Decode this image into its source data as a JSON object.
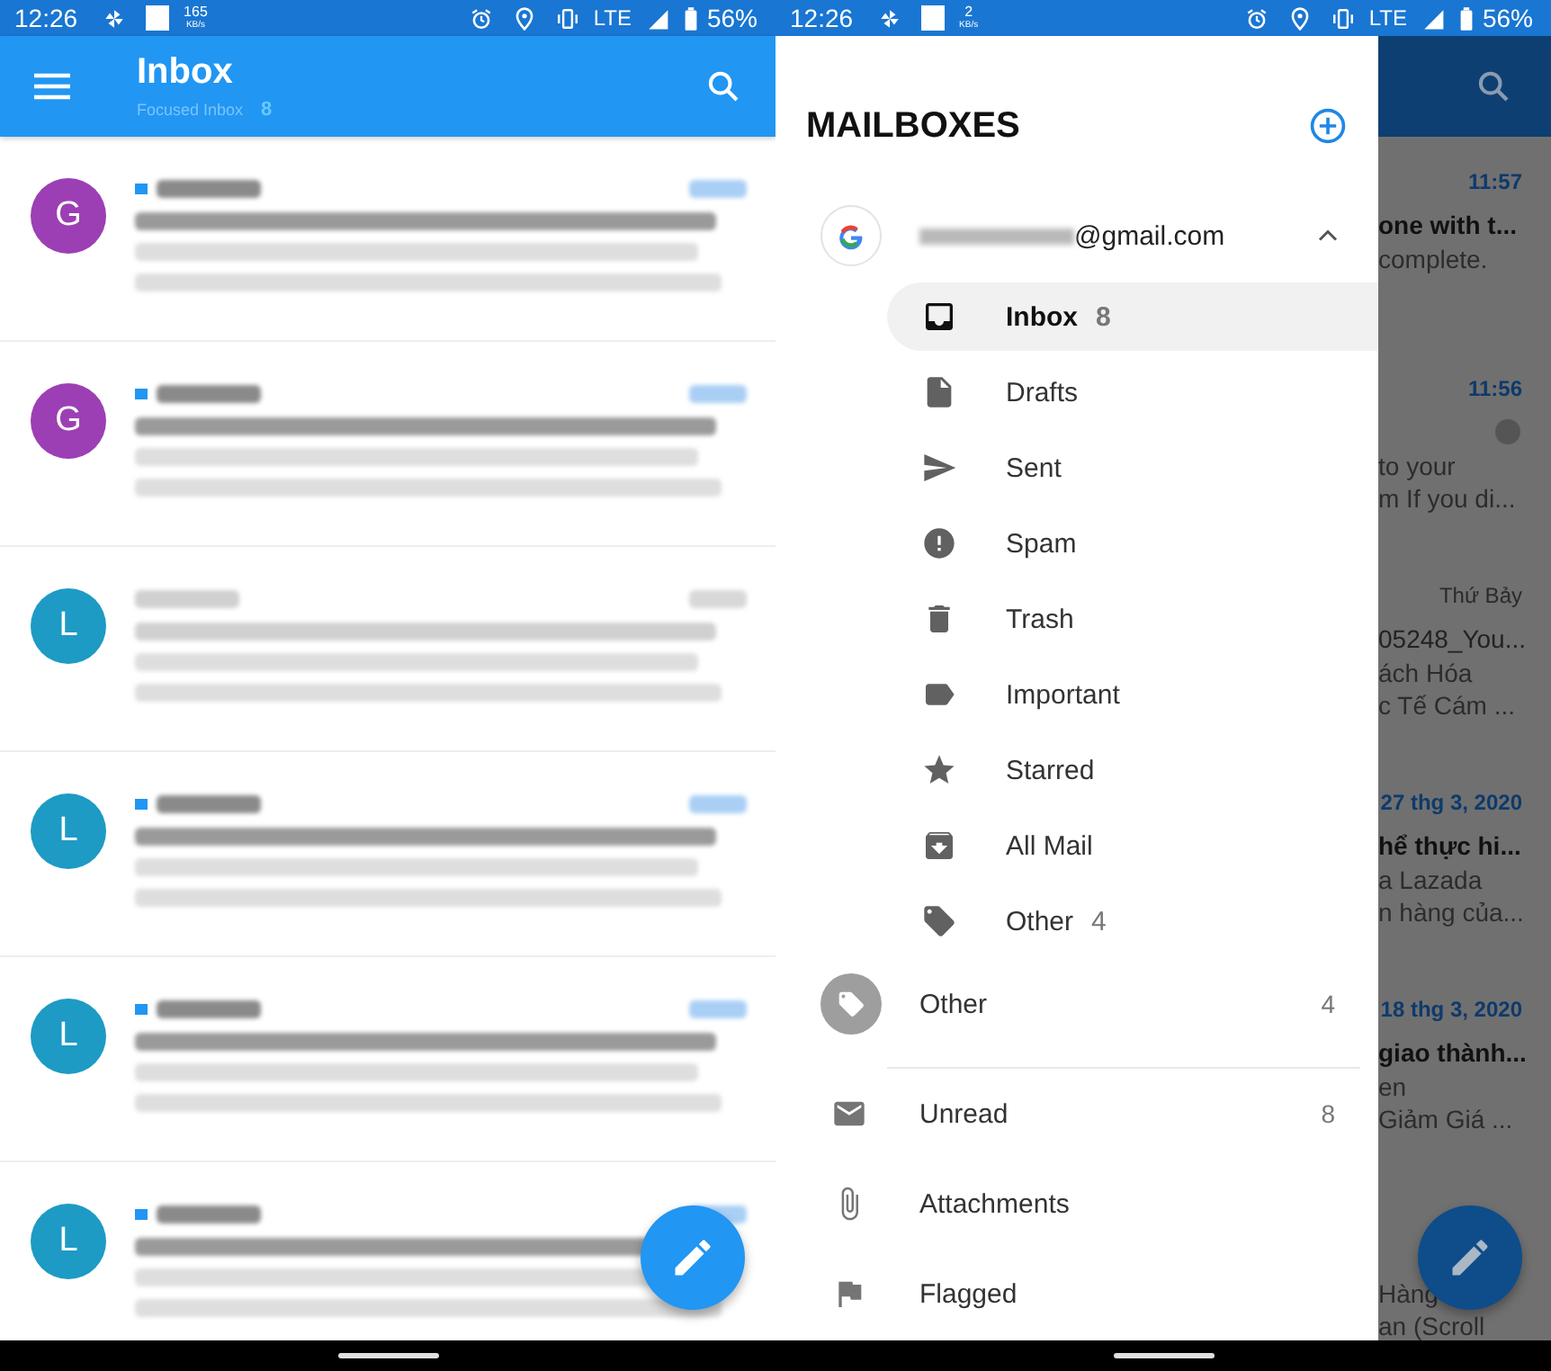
{
  "left_screen": {
    "status_bar": {
      "time": "12:26",
      "speed": "165",
      "speed_unit": "KB/s",
      "network": "LTE",
      "battery": "56%"
    },
    "app_bar": {
      "title": "Inbox",
      "subtitle": "Focused Inbox",
      "count": "8"
    },
    "messages": [
      {
        "avatar": "G",
        "color": "#9c3fb4",
        "unread": true
      },
      {
        "avatar": "G",
        "color": "#9c3fb4",
        "unread": true
      },
      {
        "avatar": "L",
        "color": "#1d9bc4",
        "unread": false
      },
      {
        "avatar": "L",
        "color": "#1d9bc4",
        "unread": true
      },
      {
        "avatar": "L",
        "color": "#1d9bc4",
        "unread": true
      },
      {
        "avatar": "L",
        "color": "#1d9bc4",
        "unread": true
      }
    ]
  },
  "right_screen": {
    "status_bar": {
      "time": "12:26",
      "speed": "2",
      "speed_unit": "KB/s",
      "network": "LTE",
      "battery": "56%"
    },
    "drawer": {
      "title": "MAILBOXES",
      "account": {
        "email_visible": "@gmail.com",
        "expanded": true
      },
      "folders": [
        {
          "kind": "inbox",
          "label": "Inbox",
          "count": "8",
          "selected": true
        },
        {
          "kind": "drafts",
          "label": "Drafts",
          "selected": false
        },
        {
          "kind": "sent",
          "label": "Sent",
          "selected": false
        },
        {
          "kind": "spam",
          "label": "Spam",
          "selected": false
        },
        {
          "kind": "trash",
          "label": "Trash",
          "selected": false
        },
        {
          "kind": "label",
          "label": "Important",
          "selected": false
        },
        {
          "kind": "star",
          "label": "Starred",
          "selected": false
        },
        {
          "kind": "allmail",
          "label": "All Mail",
          "selected": false
        },
        {
          "kind": "tag",
          "label": "Other",
          "count": "4",
          "selected": false
        }
      ],
      "other_account": {
        "label": "Other",
        "count": "4"
      },
      "filters": [
        {
          "kind": "mail",
          "label": "Unread",
          "count": "8"
        },
        {
          "kind": "attach",
          "label": "Attachments"
        },
        {
          "kind": "flag",
          "label": "Flagged"
        }
      ]
    },
    "background_rows": [
      {
        "unread": true,
        "time": "11:57",
        "subject": "one with t...",
        "snippets": [
          "complete."
        ]
      },
      {
        "unread": true,
        "time": "11:56",
        "icon": true,
        "snippets": [
          "to your",
          "m If you di..."
        ]
      },
      {
        "unread": false,
        "time": "Thứ Bảy",
        "subject": "05248_You...",
        "snippets": [
          "ách Hóa",
          "c Tế Cám ..."
        ]
      },
      {
        "unread": true,
        "time": "27 thg 3, 2020",
        "subject": "hể thực hi...",
        "snippets": [
          "a Lazada",
          "n hàng của..."
        ]
      },
      {
        "unread": true,
        "time": "18 thg 3, 2020",
        "subject": "giao thành...",
        "snippets": [
          "en",
          "Giảm Giá ..."
        ]
      },
      {
        "snippets": [
          "Hàng",
          "an (Scroll"
        ]
      }
    ]
  }
}
